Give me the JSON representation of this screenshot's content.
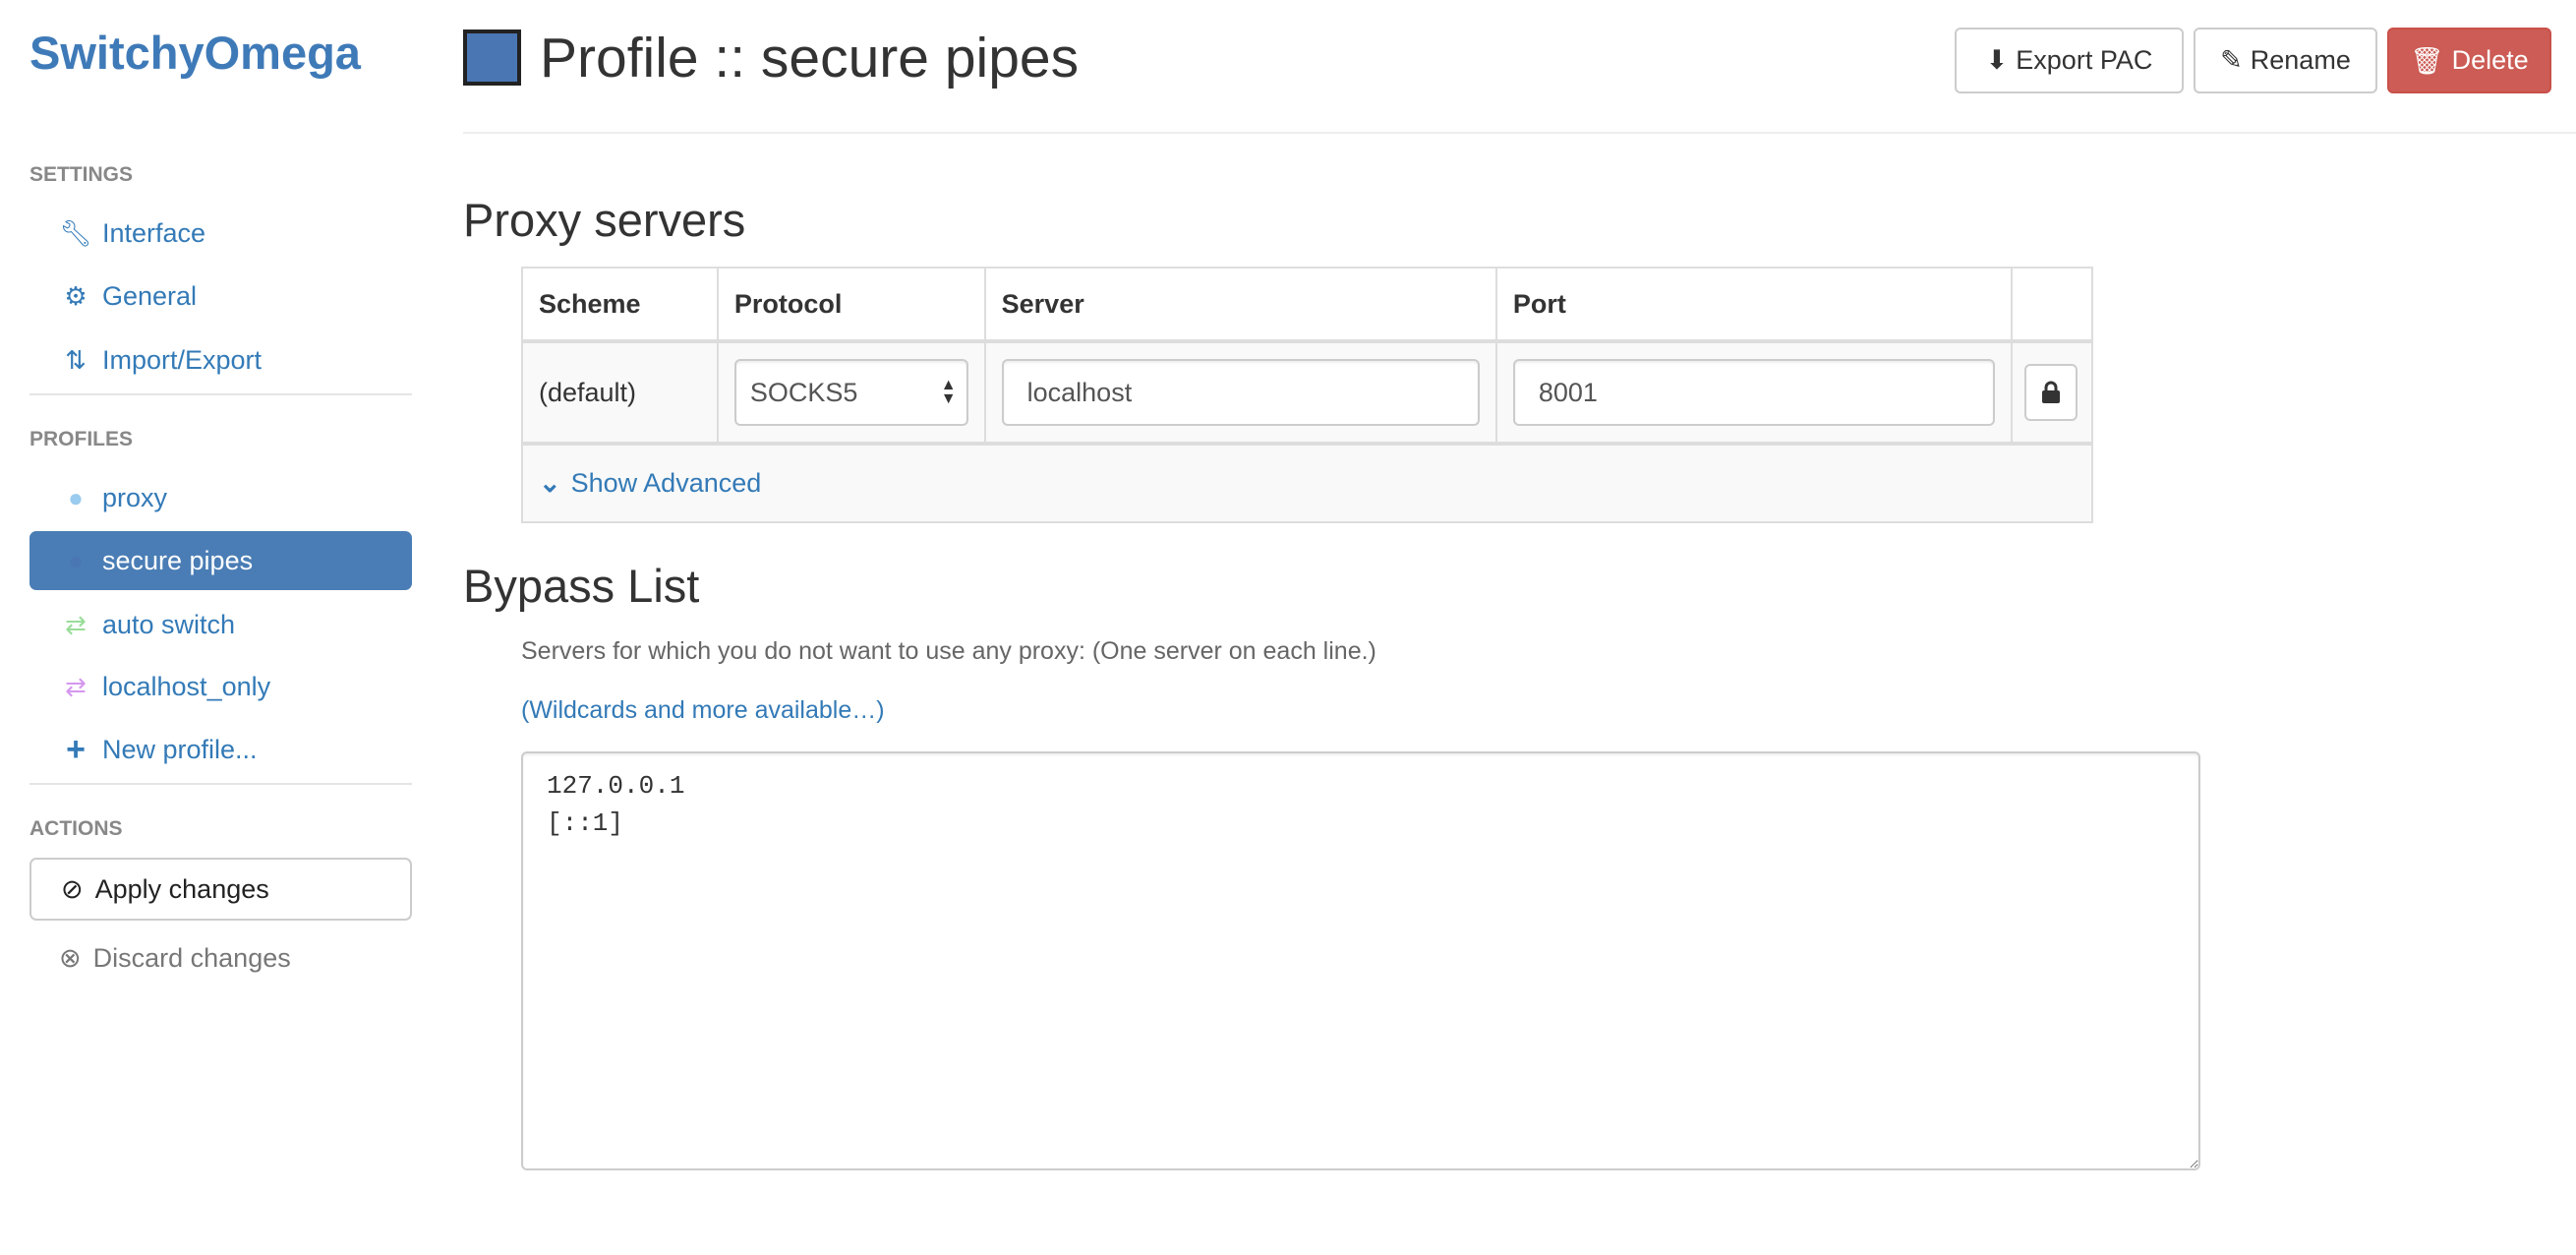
{
  "app": {
    "name": "SwitchyOmega"
  },
  "sidebar": {
    "settings_header": "SETTINGS",
    "settings": [
      {
        "label": "Interface",
        "icon": "wrench-icon"
      },
      {
        "label": "General",
        "icon": "gear-icon"
      },
      {
        "label": "Import/Export",
        "icon": "import-export-icon"
      }
    ],
    "profiles_header": "PROFILES",
    "profiles": [
      {
        "label": "proxy",
        "icon": "globe-icon",
        "color": "#99ccee"
      },
      {
        "label": "secure pipes",
        "icon": "globe-icon",
        "color": "#4a76b4",
        "active": true
      },
      {
        "label": "auto switch",
        "icon": "retweet-icon",
        "color": "#99dd99"
      },
      {
        "label": "localhost_only",
        "icon": "retweet-icon",
        "color": "#d497ee"
      }
    ],
    "new_profile": "New profile...",
    "actions_header": "ACTIONS",
    "apply": "Apply changes",
    "discard": "Discard changes"
  },
  "header": {
    "title": "Profile :: secure pipes",
    "profile_color": "#4a76b4",
    "export_pac": "Export PAC",
    "rename": "Rename",
    "delete": "Delete",
    "delete_color": "#cc5c55"
  },
  "proxy": {
    "title": "Proxy servers",
    "columns": [
      "Scheme",
      "Protocol",
      "Server",
      "Port"
    ],
    "row": {
      "scheme": "(default)",
      "protocol": "SOCKS5",
      "server": "localhost",
      "port": "8001"
    },
    "show_advanced": "Show Advanced"
  },
  "bypass": {
    "title": "Bypass List",
    "description": "Servers for which you do not want to use any proxy: (One server on each line.)",
    "link": "(Wildcards and more available…)",
    "value": "127.0.0.1\n[::1]"
  }
}
